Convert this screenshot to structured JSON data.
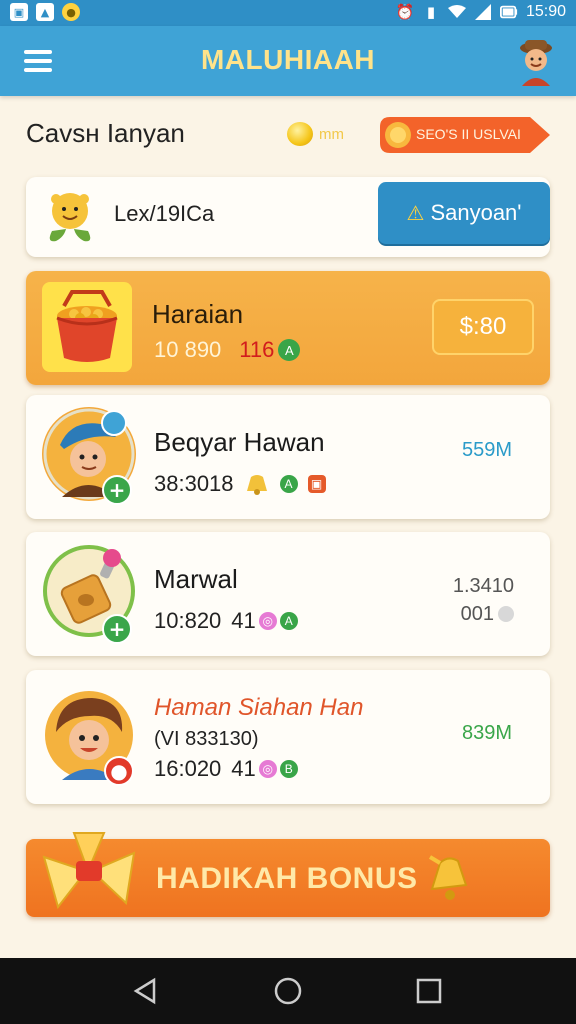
{
  "status_bar": {
    "time": "15:90"
  },
  "app_bar": {
    "title": "MALUHIAAH"
  },
  "header": {
    "title": "Cavsн Ianyan",
    "coin_text": "mm",
    "offer_label": "SEO'S II USLVAI"
  },
  "player": {
    "name": "Lex/19ICa",
    "action_label": "Sanyoan'"
  },
  "featured": {
    "title": "Haraian",
    "stat_1": "10 890",
    "stat_2": "116",
    "price_label": "$:80"
  },
  "rows": [
    {
      "name": "Beqyar Hawan",
      "stat": "38:3018",
      "value": "559M",
      "value_color": "#2b9bc9"
    },
    {
      "name": "Marwal",
      "stat": "10:820",
      "badge": "41",
      "value_line1": "1.3410",
      "value_line2": "001",
      "value_color": "#555555"
    },
    {
      "name": "Haman Siahan Han",
      "subtitle": "(VI 833130)",
      "stat": "16:020",
      "badge": "41",
      "value": "839M",
      "value_color": "#3aa64a",
      "name_color": "#e0552a"
    }
  ],
  "bonus": {
    "label": "HADIKAH BONUS"
  },
  "colors": {
    "primary_blue": "#3fa3d6",
    "accent_orange": "#f58a2e",
    "featured_gold": "#f6b34a",
    "background": "#fbf4e6"
  }
}
